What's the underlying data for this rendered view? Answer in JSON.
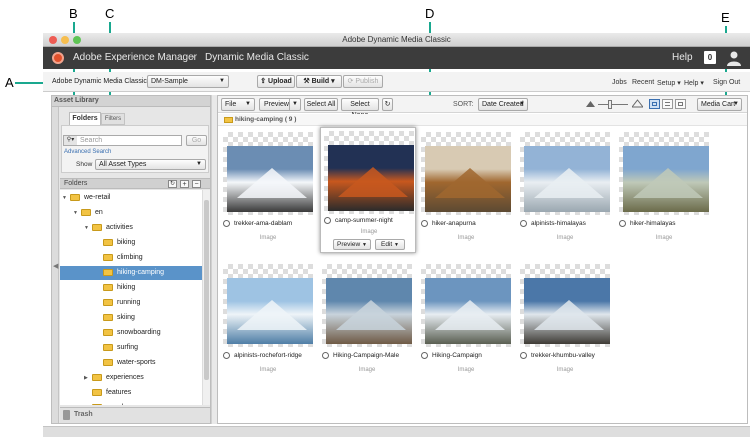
{
  "callouts": {
    "a": "A",
    "b": "B",
    "c": "C",
    "d": "D",
    "e": "E"
  },
  "window": {
    "title": "Adobe Dynamic Media Classic"
  },
  "header": {
    "brand": "Adobe Experience Manager",
    "separator": "›",
    "product": "Dynamic Media Classic",
    "help": "Help",
    "notification_count": "0"
  },
  "toolbar": {
    "company_label": "Adobe Dynamic Media Classic",
    "company_value": "DM-Sample",
    "upload": "Upload",
    "build": "Build",
    "publish": "Publish",
    "jobs": "Jobs",
    "recent": "Recent",
    "setup": "Setup",
    "help": "Help",
    "signout": "Sign Out"
  },
  "sidebar": {
    "title": "Asset Library",
    "tab_folders": "Folders",
    "tab_filters": "Filters",
    "search_placeholder": "Search",
    "go": "Go",
    "advanced_search": "Advanced Search",
    "show_label": "Show",
    "show_value": "All Asset Types",
    "folders_header": "Folders",
    "trash": "Trash",
    "tree": [
      {
        "label": "we-retail",
        "indent": 0,
        "arrow": "▼"
      },
      {
        "label": "en",
        "indent": 1,
        "arrow": "▼"
      },
      {
        "label": "activities",
        "indent": 2,
        "arrow": "▼"
      },
      {
        "label": "biking",
        "indent": 3,
        "arrow": ""
      },
      {
        "label": "climbing",
        "indent": 3,
        "arrow": ""
      },
      {
        "label": "hiking-camping",
        "indent": 3,
        "arrow": "",
        "selected": true
      },
      {
        "label": "hiking",
        "indent": 3,
        "arrow": ""
      },
      {
        "label": "running",
        "indent": 3,
        "arrow": ""
      },
      {
        "label": "skiing",
        "indent": 3,
        "arrow": ""
      },
      {
        "label": "snowboarding",
        "indent": 3,
        "arrow": ""
      },
      {
        "label": "surfing",
        "indent": 3,
        "arrow": ""
      },
      {
        "label": "water-sports",
        "indent": 3,
        "arrow": ""
      },
      {
        "label": "experiences",
        "indent": 2,
        "arrow": "▶"
      },
      {
        "label": "features",
        "indent": 2,
        "arrow": ""
      },
      {
        "label": "people",
        "indent": 2,
        "arrow": "▶"
      }
    ]
  },
  "main": {
    "file": "File",
    "preview": "Preview",
    "select_all": "Select All",
    "select_none": "Select None",
    "sort_label": "SORT:",
    "sort_value": "Date Created",
    "media_cart": "Media Cart",
    "folder_label": "hiking-camping ( 9 )",
    "card_preview": "Preview",
    "card_edit": "Edit",
    "assets": [
      {
        "name": "trekker-ama-dablam",
        "type": "Image"
      },
      {
        "name": "camp-summer-night",
        "type": "Image",
        "hover": true
      },
      {
        "name": "hiker-anapurna",
        "type": "Image"
      },
      {
        "name": "alpinists-himalayas",
        "type": "Image"
      },
      {
        "name": "hiker-himalayas",
        "type": "Image"
      },
      {
        "name": "alpinists-rochefort-ridge",
        "type": "Image"
      },
      {
        "name": "Hiking-Campaign-Male",
        "type": "Image"
      },
      {
        "name": "Hiking-Campaign",
        "type": "Image"
      },
      {
        "name": "trekker-khumbu-valley",
        "type": "Image"
      }
    ]
  },
  "colors": {
    "accent": "#1aa88f",
    "header": "#3c3c3c",
    "selected": "#5a93c9"
  }
}
